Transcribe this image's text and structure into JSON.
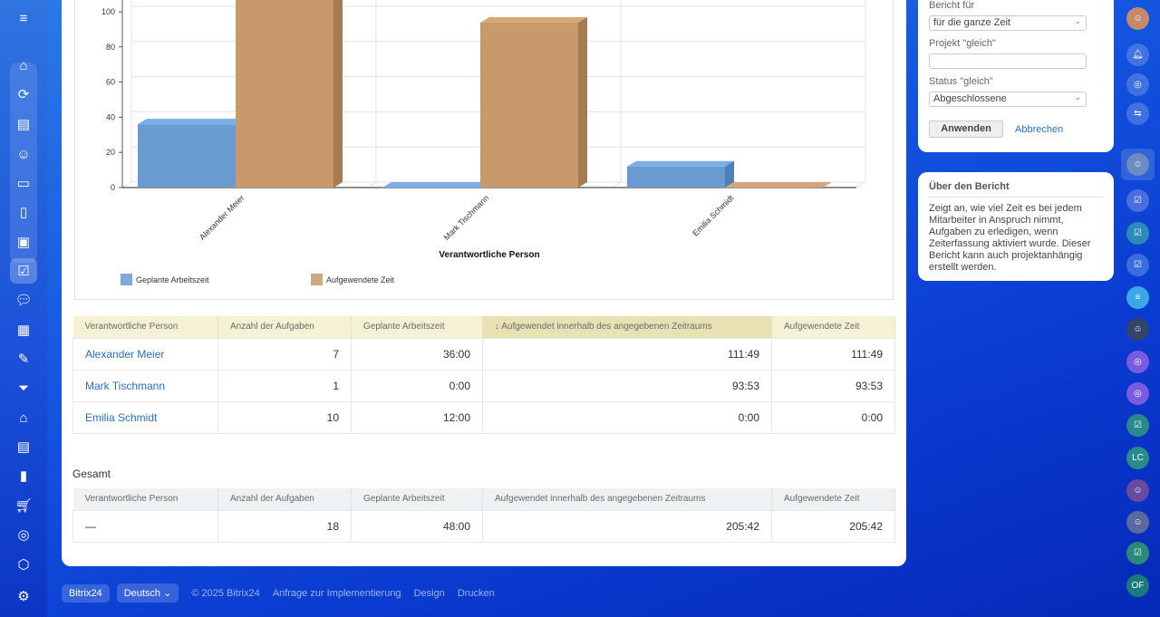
{
  "leftbar": {
    "icons": [
      "menu-icon",
      "home-icon",
      "feed-icon",
      "news-icon",
      "contacts-icon",
      "crm-icon",
      "docs-icon",
      "board-icon",
      "tasks-icon",
      "chat-icon",
      "calendar-icon",
      "sign-icon",
      "funnel-icon",
      "warehouse-icon",
      "card-icon",
      "analytics-icon",
      "cart-icon",
      "target-icon",
      "package-icon",
      "settings-icon"
    ]
  },
  "chart_data": {
    "type": "bar",
    "categories": [
      "Alexander Meier",
      "Mark Tischmann",
      "Emilia Schmidt"
    ],
    "series": [
      {
        "name": "Geplante Arbeitszeit",
        "values": [
          36,
          0,
          12
        ],
        "color": "#6a9bd0"
      },
      {
        "name": "Aufgewendete Zeit",
        "values": [
          111.8,
          93.9,
          0
        ],
        "color": "#c8996a"
      }
    ],
    "xlabel": "Verantwortliche Person",
    "ylabel": "",
    "yticks": [
      0,
      20,
      40,
      60,
      80,
      100
    ],
    "ylim": [
      0,
      120
    ],
    "legend": "bottom-left",
    "grid": true
  },
  "table": {
    "headers": [
      "Verantwortliche Person",
      "Anzahl der Aufgaben",
      "Geplante Arbeitszeit",
      "↓ Aufgewendet innerhalb des angegebenen Zeitraums",
      "Aufgewendete Zeit"
    ],
    "rows": [
      [
        "Alexander Meier",
        "7",
        "36:00",
        "111:49",
        "111:49"
      ],
      [
        "Mark Tischmann",
        "1",
        "0:00",
        "93:53",
        "93:53"
      ],
      [
        "Emilia Schmidt",
        "10",
        "12:00",
        "0:00",
        "0:00"
      ]
    ]
  },
  "total": {
    "title": "Gesamt",
    "headers": [
      "Verantwortliche Person",
      "Anzahl der Aufgaben",
      "Geplante Arbeitszeit",
      "Aufgewendet innerhalb des angegebenen Zeitraums",
      "Aufgewendete Zeit"
    ],
    "row": [
      "—",
      "18",
      "48:00",
      "205:42",
      "205:42"
    ]
  },
  "filter": {
    "report_for_label": "Bericht für",
    "report_for_value": "für die ganze Zeit",
    "project_label": "Projekt \"gleich\"",
    "project_value": "",
    "status_label": "Status \"gleich\"",
    "status_value": "Abgeschlossene",
    "apply": "Anwenden",
    "cancel": "Abbrechen"
  },
  "about": {
    "title": "Über den Bericht",
    "text": "Zeigt an, wie viel Zeit es bei jedem Mitarbeiter in Anspruch nimmt, Aufgaben zu erledigen, wenn Zeiterfassung aktiviert wurde. Dieser Bericht kann auch projektanhängig erstellt werden."
  },
  "footer": {
    "brand": "Bitrix24",
    "language": "Deutsch",
    "copyright": "© 2025 Bitrix24",
    "links": [
      "Anfrage zur Implementierung",
      "Design",
      "Drucken"
    ]
  },
  "rightbar": {
    "lc": "LC",
    "of": "OF"
  }
}
